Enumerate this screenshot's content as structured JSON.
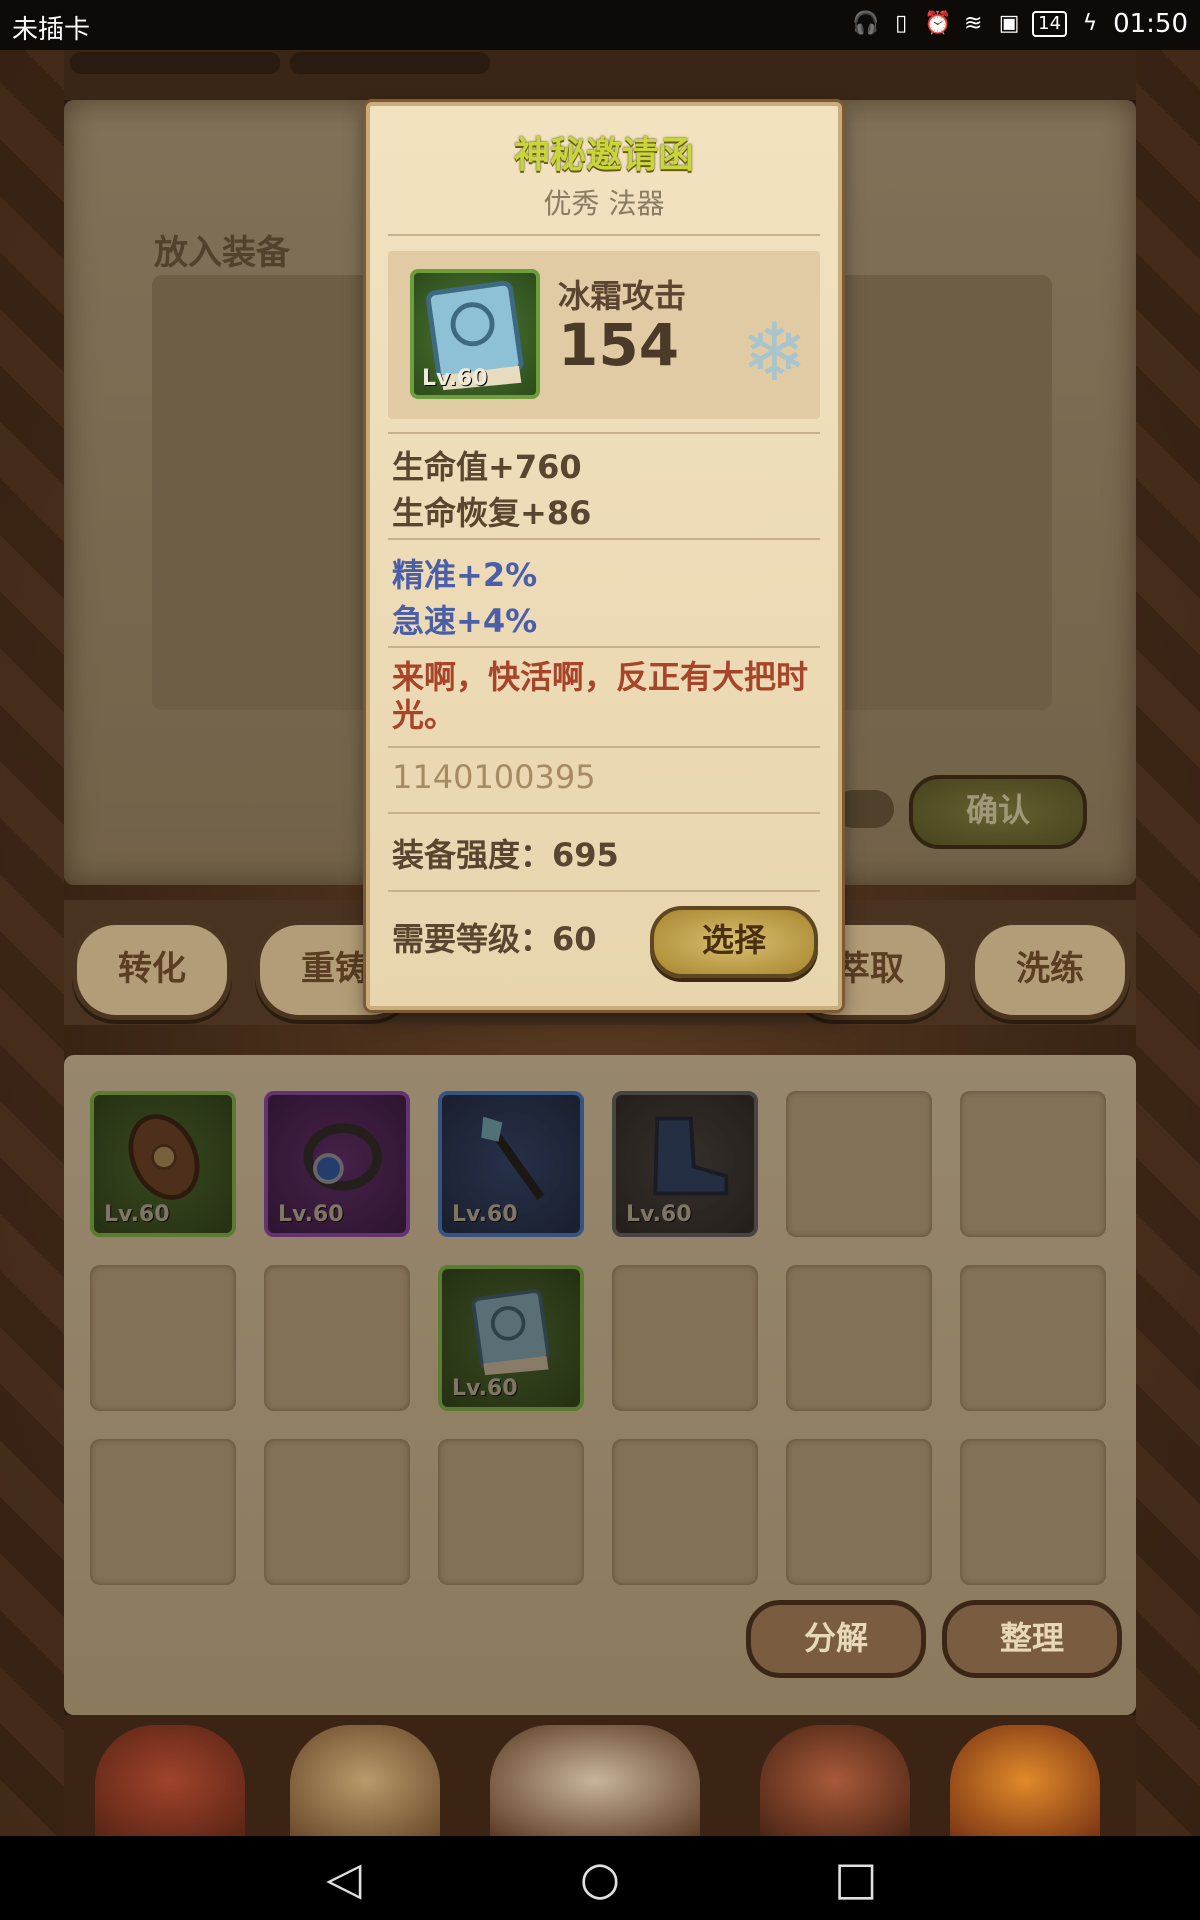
{
  "status_bar": {
    "carrier": "未插卡",
    "battery": "14",
    "time": "01:50"
  },
  "upper_panel": {
    "put_equipment_label": "放入装备",
    "confirm_label": "确认"
  },
  "tabs": [
    {
      "label": "转化"
    },
    {
      "label": "重铸"
    },
    {
      "label": "萃取"
    },
    {
      "label": "洗练"
    }
  ],
  "inventory": {
    "items": [
      {
        "name": "shield",
        "level": "Lv.60",
        "rarity": "green"
      },
      {
        "name": "ring",
        "level": "Lv.60",
        "rarity": "purple"
      },
      {
        "name": "staff",
        "level": "Lv.60",
        "rarity": "blue"
      },
      {
        "name": "boots",
        "level": "Lv.60",
        "rarity": "grey"
      },
      {
        "name": "book",
        "level": "Lv.60",
        "rarity": "green"
      }
    ],
    "decompose_label": "分解",
    "organize_label": "整理"
  },
  "tooltip": {
    "title": "神秘邀请函",
    "subtitle": "优秀 法器",
    "level": "Lv.60",
    "main_stat_name": "冰霜攻击",
    "main_stat_value": "154",
    "base_stats": [
      "生命值+760",
      "生命恢复+86"
    ],
    "bonus_stats": [
      "精准+2%",
      "急速+4%"
    ],
    "flavor_text": "来啊，快活啊，反正有大把时光。",
    "item_id": "1140100395",
    "equip_strength": "装备强度：695",
    "required_level": "需要等级：60",
    "select_label": "选择"
  },
  "colors": {
    "title": "#c9d63a",
    "bonus_stat": "#4b5ea8",
    "flavor": "#a8442a",
    "rarity_green": "#6e9e3c",
    "rarity_purple": "#7a3c95",
    "rarity_blue": "#3c6aa8"
  }
}
